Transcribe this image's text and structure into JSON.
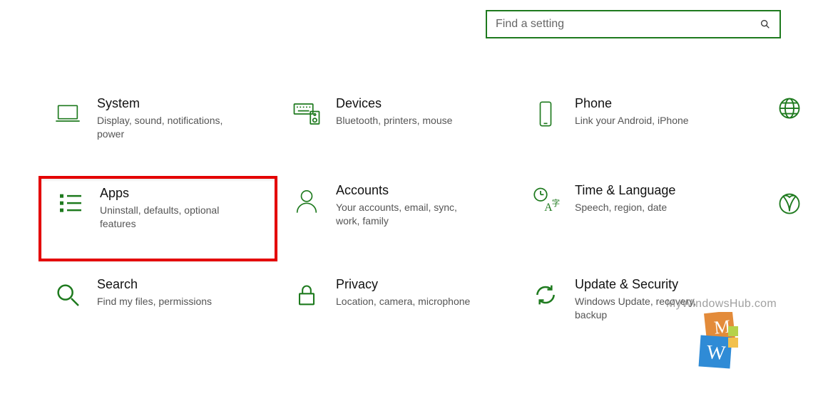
{
  "search": {
    "placeholder": "Find a setting"
  },
  "tiles": {
    "system": {
      "title": "System",
      "desc": "Display, sound, notifications, power"
    },
    "devices": {
      "title": "Devices",
      "desc": "Bluetooth, printers, mouse"
    },
    "phone": {
      "title": "Phone",
      "desc": "Link your Android, iPhone"
    },
    "apps": {
      "title": "Apps",
      "desc": "Uninstall, defaults, optional features"
    },
    "accounts": {
      "title": "Accounts",
      "desc": "Your accounts, email, sync, work, family"
    },
    "time": {
      "title": "Time & Language",
      "desc": "Speech, region, date"
    },
    "search": {
      "title": "Search",
      "desc": "Find my files, permissions"
    },
    "privacy": {
      "title": "Privacy",
      "desc": "Location, camera, microphone"
    },
    "update": {
      "title": "Update & Security",
      "desc": "Windows Update, recovery, backup"
    }
  },
  "watermark": "MyWindowsHub.com",
  "colors": {
    "accent": "#1e7a1e",
    "highlight": "#e40000"
  }
}
